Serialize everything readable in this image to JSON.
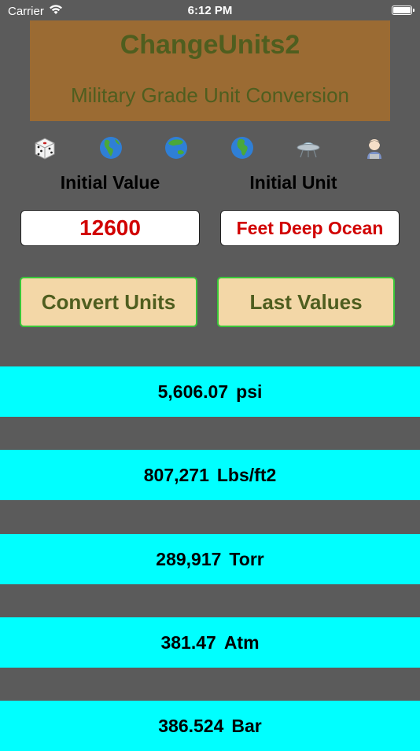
{
  "status_bar": {
    "carrier": "Carrier",
    "time": "6:12 PM"
  },
  "banner": {
    "title": "ChangeUnits2",
    "subtitle": "Military Grade Unit Conversion",
    "color": "#9b6b33",
    "text_color": "#4f5e1f"
  },
  "icons": [
    {
      "name": "dice-icon"
    },
    {
      "name": "globe-americas-icon"
    },
    {
      "name": "globe-asia-australia-icon"
    },
    {
      "name": "globe-europe-africa-icon"
    },
    {
      "name": "flying-saucer-icon"
    },
    {
      "name": "woman-technologist-icon"
    }
  ],
  "labels": {
    "initial_value": "Initial Value",
    "initial_unit": "Initial Unit"
  },
  "inputs": {
    "initial_value": "12600",
    "initial_unit": "Feet Deep Ocean"
  },
  "buttons": {
    "convert": "Convert Units",
    "last_values": "Last Values"
  },
  "results": [
    {
      "value": "5,606.07",
      "unit": "psi"
    },
    {
      "value": "807,271",
      "unit": "Lbs/ft2"
    },
    {
      "value": "289,917",
      "unit": "Torr"
    },
    {
      "value": "381.47",
      "unit": "Atm"
    },
    {
      "value": "386.524",
      "unit": "Bar"
    }
  ],
  "colors": {
    "background": "#5b5b5b",
    "result_row": "#00ffff",
    "button_fill": "#f3d7a7",
    "button_border": "#39c639",
    "input_text": "#d10000"
  }
}
